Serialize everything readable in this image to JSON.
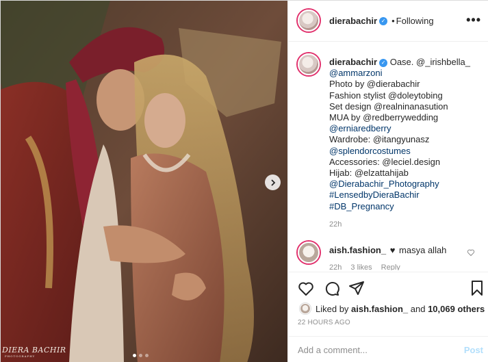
{
  "post": {
    "author": "dierabachir",
    "follow_state": "Following",
    "more_label": "•••",
    "caption_lines": [
      "Oase. @_irishbella_",
      "@ammarzoni",
      "Photo by @dierabachir",
      "Fashion stylist @doleytobing",
      "Set design @realninanasution",
      "MUA by @redberrywedding",
      "@erniaredberry",
      "Wardrobe: @itangyunasz",
      "@splendorcostumes",
      "Accessories: @leciel.design",
      "Hijab: @elzattahijab",
      "@Dierabachir_Photography",
      "#LensedbyDieraBachir",
      "#DB_Pregnancy"
    ],
    "caption_time": "22h",
    "comment": {
      "user": "aish.fashion_",
      "text": "masya allah",
      "time": "22h",
      "likes": "3 likes",
      "reply": "Reply"
    },
    "likes": {
      "prefix": "Liked by",
      "user": "aish.fashion_",
      "middle": "and",
      "count": "10,069 others"
    },
    "timestamp": "22 HOURS AGO",
    "add_comment_placeholder": "Add a comment...",
    "post_button": "Post",
    "watermark_main": "DIERA BACHIR",
    "watermark_sub": "PHOTOGRAPHY"
  },
  "carousel": {
    "current": 1,
    "total": 3
  },
  "colors": {
    "accent": "#3897f0",
    "link": "#003569",
    "muted": "#8e8e8e",
    "story_ring": "#e1306c"
  }
}
